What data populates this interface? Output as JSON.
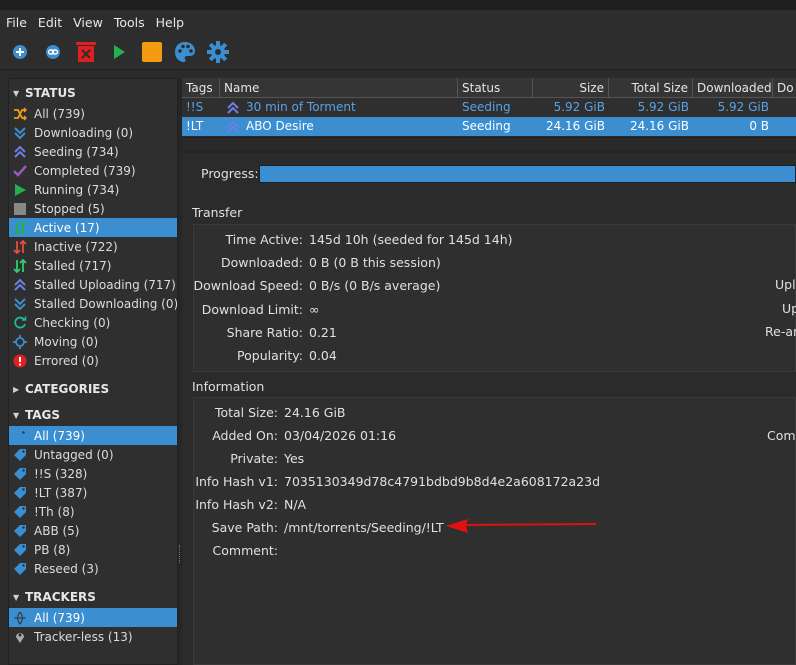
{
  "menu": [
    {
      "label": "File"
    },
    {
      "label": "Edit"
    },
    {
      "label": "View"
    },
    {
      "label": "Tools"
    },
    {
      "label": "Help"
    }
  ],
  "toolbar": {
    "buttons": [
      {
        "name": "add-torrent-button",
        "icon": "plus-circle-icon",
        "color": "#3b8ed0"
      },
      {
        "name": "add-link-button",
        "icon": "link-icon",
        "color": "#3b8ed0"
      },
      {
        "name": "delete-button",
        "icon": "trash-icon",
        "color": "#e02020"
      },
      {
        "name": "resume-button",
        "icon": "play-icon",
        "color": "#22b14c"
      },
      {
        "name": "pause-button",
        "icon": "stop-square-icon",
        "color": "#f39c12"
      },
      {
        "name": "theme-button",
        "icon": "palette-icon",
        "color": "#3b8ed0"
      },
      {
        "name": "options-button",
        "icon": "gear-icon",
        "color": "#3b8ed0"
      }
    ]
  },
  "sidebar": {
    "status_title": "STATUS",
    "status_items": [
      {
        "label": "All (739)",
        "icon": "shuffle-icon",
        "color": "#f39c12"
      },
      {
        "label": "Downloading (0)",
        "icon": "double-chevron-down-icon",
        "color": "#3b8ed0"
      },
      {
        "label": "Seeding (734)",
        "icon": "double-chevron-up-icon",
        "color": "#6c7ee8"
      },
      {
        "label": "Completed (739)",
        "icon": "check-icon",
        "color": "#9b59b6"
      },
      {
        "label": "Running (734)",
        "icon": "play-icon",
        "color": "#22b14c"
      },
      {
        "label": "Stopped (5)",
        "icon": "square-icon",
        "color": "#888888"
      },
      {
        "label": "Active (17)",
        "icon": "arrows-updown-icon",
        "color": "#22b14c"
      },
      {
        "label": "Inactive (722)",
        "icon": "arrows-updown-icon",
        "color": "#e74c3c"
      },
      {
        "label": "Stalled (717)",
        "icon": "arrows-updown-icon",
        "color": "#2ecc71"
      },
      {
        "label": "Stalled Uploading (717)",
        "icon": "double-chevron-up-icon",
        "color": "#6c7ee8"
      },
      {
        "label": "Stalled Downloading (0)",
        "icon": "double-chevron-down-icon",
        "color": "#3b8ed0"
      },
      {
        "label": "Checking (0)",
        "icon": "refresh-icon",
        "color": "#1abc9c"
      },
      {
        "label": "Moving (0)",
        "icon": "move-icon",
        "color": "#3b8ed0"
      },
      {
        "label": "Errored (0)",
        "icon": "error-icon",
        "color": "#e02020"
      }
    ],
    "categories_title": "CATEGORIES",
    "tags_title": "TAGS",
    "tag_items": [
      {
        "label": "All (739)"
      },
      {
        "label": "Untagged (0)"
      },
      {
        "label": "!!S (328)"
      },
      {
        "label": "!LT (387)"
      },
      {
        "label": "!Th (8)"
      },
      {
        "label": "ABB (5)"
      },
      {
        "label": "PB (8)"
      },
      {
        "label": "Reseed (3)"
      }
    ],
    "tag_icon": "tag-icon",
    "trackers_title": "TRACKERS",
    "tracker_items": [
      {
        "label": "All (739)",
        "icon": "globe-icon"
      },
      {
        "label": "Tracker-less (13)",
        "icon": "pin-icon"
      }
    ]
  },
  "torrents": {
    "columns": [
      "Tags",
      "Name",
      "Status",
      "Size",
      "Total Size",
      "Downloaded",
      "Do"
    ],
    "rows": [
      {
        "tags": "!!S",
        "name": "30 min of Torment",
        "status": "Seeding",
        "size": "5.92 GiB",
        "total_size": "5.92 GiB",
        "downloaded": "5.92 GiB"
      },
      {
        "tags": "!LT",
        "name": "ABO Desire",
        "status": "Seeding",
        "size": "24.16 GiB",
        "total_size": "24.16 GiB",
        "downloaded": "0 B"
      }
    ]
  },
  "details": {
    "progress_label": "Progress:",
    "progress": 1.0,
    "transfer_title": "Transfer",
    "transfer": [
      {
        "label": "Time Active:",
        "value": "145d 10h (seeded for 145d 14h)"
      },
      {
        "label": "Downloaded:",
        "value": "0 B (0 B this session)"
      },
      {
        "label": "Download Speed:",
        "value": "0 B/s (0 B/s average)"
      },
      {
        "label": "Download Limit:",
        "value": "∞"
      },
      {
        "label": "Share Ratio:",
        "value": "0.21"
      },
      {
        "label": "Popularity:",
        "value": "0.04"
      }
    ],
    "transfer_right": [
      "Uplo",
      "Up",
      "Re-an"
    ],
    "information_title": "Information",
    "information": [
      {
        "label": "Total Size:",
        "value": "24.16 GiB"
      },
      {
        "label": "Added On:",
        "value": "03/04/2026 01:16"
      },
      {
        "label": "Private:",
        "value": "Yes"
      },
      {
        "label": "Info Hash v1:",
        "value": "7035130349d78c4791bdbd9b8d4e2a608172a23d"
      },
      {
        "label": "Info Hash v2:",
        "value": "N/A"
      },
      {
        "label": "Save Path:",
        "value": "/mnt/torrents/Seeding/!LT"
      },
      {
        "label": "Comment:",
        "value": ""
      }
    ],
    "information_right": "Comp"
  },
  "annotation": {
    "color": "#e01010"
  }
}
